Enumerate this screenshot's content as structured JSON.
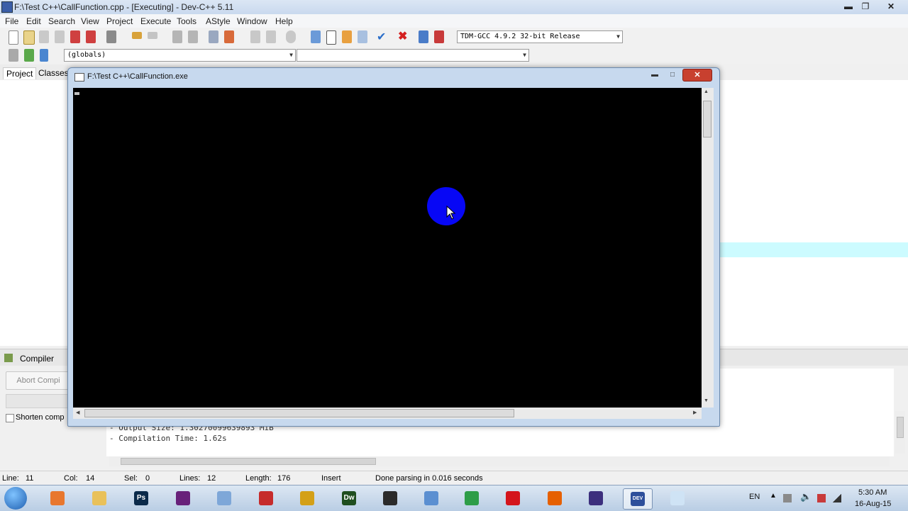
{
  "window": {
    "title": "F:\\Test C++\\CallFunction.cpp - [Executing] - Dev-C++ 5.11"
  },
  "menu": [
    "File",
    "Edit",
    "Search",
    "View",
    "Project",
    "Execute",
    "Tools",
    "AStyle",
    "Window",
    "Help"
  ],
  "toolbar": {
    "compiler_select": "TDM-GCC 4.9.2 32-bit Release",
    "scope_select": "(globals)",
    "function_select": ""
  },
  "left_tabs": {
    "project": "Project",
    "classes": "Classes"
  },
  "bottom": {
    "compiler_tab": "Compiler",
    "abort_button": "Abort Compi",
    "shorten_label": "Shorten comp",
    "log_lines": [
      "- Output Size: 1.30270099639893 MiB",
      "- Compilation Time: 1.62s"
    ]
  },
  "status": {
    "line_label": "Line:",
    "line_val": "11",
    "col_label": "Col:",
    "col_val": "14",
    "sel_label": "Sel:",
    "sel_val": "0",
    "lines_label": "Lines:",
    "lines_val": "12",
    "length_label": "Length:",
    "length_val": "176",
    "mode": "Insert",
    "message": "Done parsing in 0.016 seconds"
  },
  "console": {
    "title": "F:\\Test C++\\CallFunction.exe"
  },
  "taskbar": {
    "apps": [
      {
        "name": "media-player",
        "color": "#e8772e"
      },
      {
        "name": "file-explorer",
        "color": "#e9c15a"
      },
      {
        "name": "photoshop",
        "color": "#0b2a4a",
        "label": "Ps"
      },
      {
        "name": "visual-studio",
        "color": "#68217a"
      },
      {
        "name": "virtualbox",
        "color": "#7ea7d8"
      },
      {
        "name": "ruby-app",
        "color": "#c62b2b"
      },
      {
        "name": "tools-app",
        "color": "#d4a017"
      },
      {
        "name": "dreamweaver",
        "color": "#1f4e1f",
        "label": "Dw"
      },
      {
        "name": "console-app",
        "color": "#2b2b2b"
      },
      {
        "name": "network-app",
        "color": "#5b8fd1"
      },
      {
        "name": "chrome",
        "color": "#2e9d48"
      },
      {
        "name": "opera",
        "color": "#d4151c"
      },
      {
        "name": "firefox",
        "color": "#e66000"
      },
      {
        "name": "eclipse",
        "color": "#3c2f7d"
      },
      {
        "name": "dev-cpp",
        "color": "#2d4f9b",
        "label": "DEV"
      },
      {
        "name": "notepad",
        "color": "#cfe3f5"
      }
    ],
    "lang": "EN",
    "time": "5:30 AM",
    "date": "16-Aug-15"
  }
}
